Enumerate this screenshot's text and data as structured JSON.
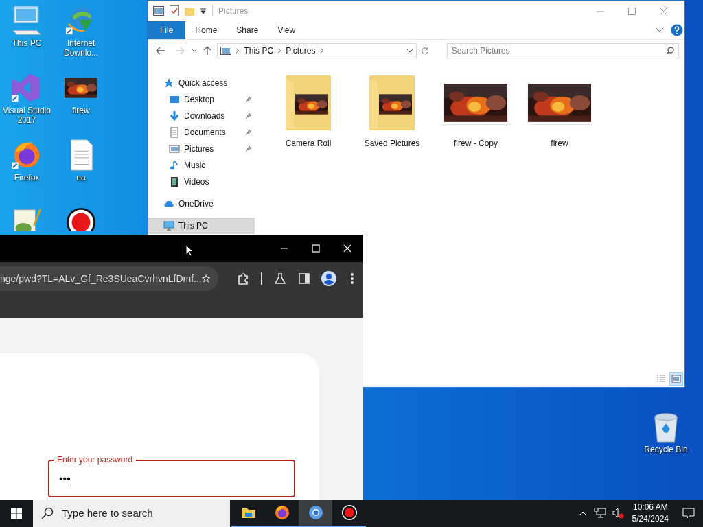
{
  "desktop_icons": [
    {
      "label": "This PC",
      "kind": "pc"
    },
    {
      "label": "Internet Downlo...",
      "kind": "idm"
    },
    {
      "label": "Visual Studio 2017",
      "kind": "vs"
    },
    {
      "label": "firew",
      "kind": "picture"
    },
    {
      "label": "Firefox",
      "kind": "firefox"
    },
    {
      "label": "ea",
      "kind": "text"
    },
    {
      "kind": "notepad"
    },
    {
      "kind": "record"
    },
    {
      "label": "Recycle Bin",
      "kind": "recycle"
    }
  ],
  "explorer": {
    "title": "Pictures",
    "ribbon_tabs": [
      {
        "label": "File",
        "selected": true
      },
      {
        "label": "Home",
        "selected": false
      },
      {
        "label": "Share",
        "selected": false
      },
      {
        "label": "View",
        "selected": false
      }
    ],
    "breadcrumb": [
      "This PC",
      "Pictures"
    ],
    "search": {
      "placeholder": "Search Pictures"
    },
    "nav": [
      {
        "label": "Quick access",
        "kind": "star",
        "selected": false,
        "children": [
          {
            "label": "Desktop",
            "kind": "desktop",
            "pinned": true,
            "selected": false
          },
          {
            "label": "Downloads",
            "kind": "download",
            "pinned": true,
            "selected": false
          },
          {
            "label": "Documents",
            "kind": "documents",
            "pinned": true,
            "selected": false
          },
          {
            "label": "Pictures",
            "kind": "pictures",
            "pinned": true,
            "selected": false
          },
          {
            "label": "Music",
            "kind": "music",
            "pinned": false,
            "selected": false
          },
          {
            "label": "Videos",
            "kind": "videos",
            "pinned": false,
            "selected": false
          }
        ]
      },
      {
        "label": "OneDrive",
        "kind": "cloud",
        "selected": false
      },
      {
        "label": "This PC",
        "kind": "pc",
        "selected": true
      }
    ],
    "files": [
      {
        "name": "Camera Roll",
        "kind": "folder"
      },
      {
        "name": "Saved Pictures",
        "kind": "folder"
      },
      {
        "name": "firew - Copy"
      },
      {
        "name": "firew"
      }
    ],
    "view_buttons": [
      {
        "kind": "details",
        "selected": false
      },
      {
        "kind": "large",
        "selected": true
      }
    ]
  },
  "browser": {
    "url": "nge/pwd?TL=ALv_Gf_Re3SUeaCvrhvnLfDmf...",
    "password_field": {
      "label": "Enter your password",
      "value": "•••"
    }
  },
  "taskbar": {
    "search": {
      "placeholder": "Type here to search"
    },
    "apps": [
      {
        "kind": "explorer",
        "selected": false
      },
      {
        "kind": "firefox",
        "selected": false
      },
      {
        "kind": "chrome",
        "selected": true
      },
      {
        "kind": "record",
        "selected": false
      }
    ],
    "time": "10:06 AM",
    "date": "5/24/2024"
  }
}
